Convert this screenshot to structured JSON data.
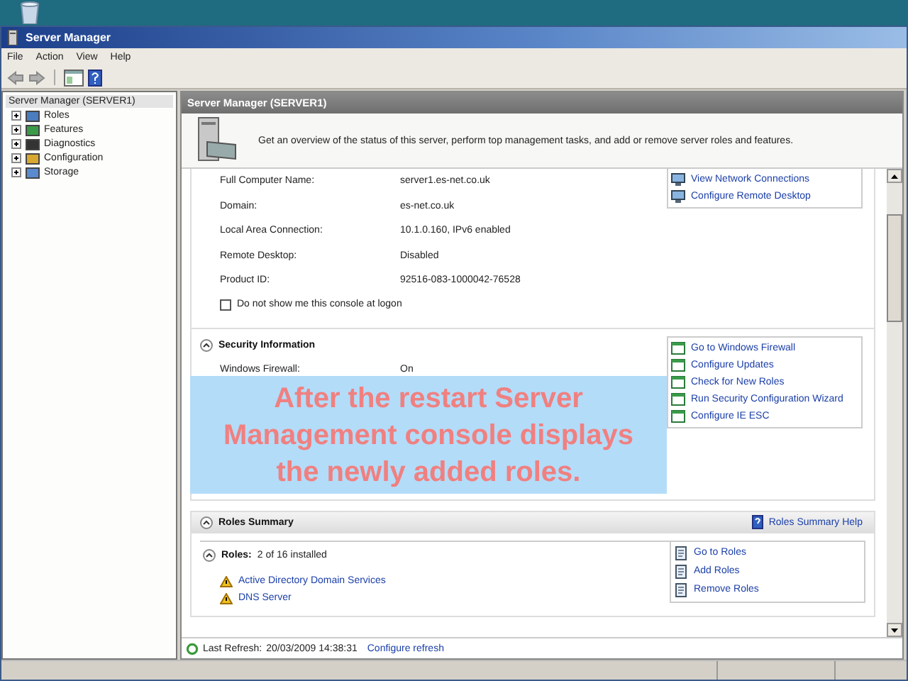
{
  "window": {
    "title": "Server Manager"
  },
  "menu": [
    "File",
    "Action",
    "View",
    "Help"
  ],
  "tree": {
    "label": "Server Manager (SERVER1)",
    "selected": true,
    "children": [
      {
        "label": "Roles",
        "kind": "roles",
        "expanded": false
      },
      {
        "label": "Features",
        "kind": "features",
        "expanded": false
      },
      {
        "label": "Diagnostics",
        "kind": "diagnostics",
        "expanded": false
      },
      {
        "label": "Configuration",
        "kind": "configuration",
        "expanded": false
      },
      {
        "label": "Storage",
        "kind": "storage",
        "expanded": false
      }
    ]
  },
  "pane": {
    "title": "Server Manager (SERVER1)",
    "description": "Get an overview of the status of this server, perform top management tasks, and add or remove server roles and features."
  },
  "computer_info": {
    "rows": [
      {
        "label": "Full Computer Name:",
        "value": "server1.es-net.co.uk"
      },
      {
        "label": "Domain:",
        "value": "es-net.co.uk"
      },
      {
        "label": "Local Area Connection:",
        "value": "10.1.0.160, IPv6 enabled"
      },
      {
        "label": "Remote Desktop:",
        "value": "Disabled"
      },
      {
        "label": "Product ID:",
        "value": "92516-083-1000042-76528"
      }
    ],
    "links": [
      "View Network Connections",
      "Configure Remote Desktop"
    ],
    "checkbox": {
      "label": "Do not show me this console at logon",
      "checked": false
    }
  },
  "security": {
    "title": "Security Information",
    "rows": [
      {
        "label": "Windows Firewall:",
        "value": "On"
      }
    ],
    "links": [
      "Go to Windows Firewall",
      "Configure Updates",
      "Check for New Roles",
      "Run Security Configuration Wizard",
      "Configure IE ESC"
    ]
  },
  "roles_summary": {
    "title": "Roles Summary",
    "help_link": "Roles Summary Help",
    "roles_label": "Roles:",
    "roles_count": "2 of 16 installed",
    "roles": [
      "Active Directory Domain Services",
      "DNS Server"
    ],
    "links": [
      "Go to Roles",
      "Add Roles",
      "Remove Roles"
    ]
  },
  "last_refresh": {
    "label": "Last Refresh:",
    "value": "20/03/2009 14:38:31",
    "link": "Configure refresh"
  },
  "callout": "After the restart Server Management console displays the newly added roles."
}
